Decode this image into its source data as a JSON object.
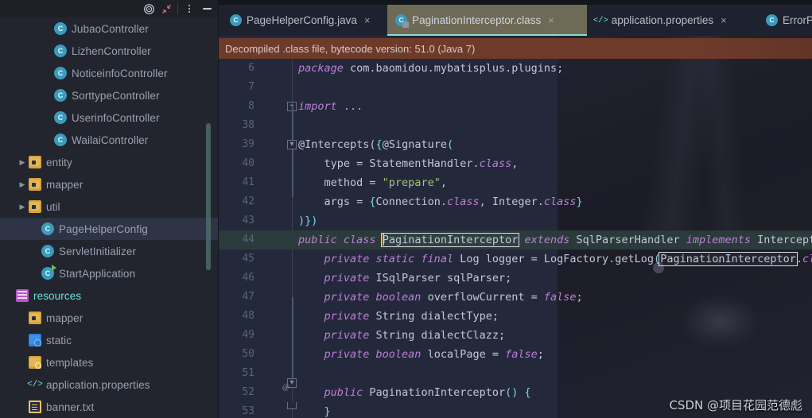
{
  "window": {
    "toolbar_buttons": [
      {
        "name": "locate-in-tree",
        "icon": "target-icon",
        "label": ""
      },
      {
        "name": "collapse-all",
        "icon": "collapse-arrows-icon",
        "label": ""
      },
      {
        "name": "options-menu",
        "icon": "kebab-menu-icon",
        "label": ""
      },
      {
        "name": "hide-panel",
        "icon": "minimize-icon",
        "label": ""
      }
    ]
  },
  "sidebar": {
    "items": [
      {
        "label": "JubaoController",
        "icon": "java-class-icon",
        "indent": 3,
        "arrow": "",
        "selected": false
      },
      {
        "label": "LizhenController",
        "icon": "java-class-icon",
        "indent": 3,
        "arrow": "",
        "selected": false
      },
      {
        "label": "NoticeinfoController",
        "icon": "java-class-icon",
        "indent": 3,
        "arrow": "",
        "selected": false
      },
      {
        "label": "SorttypeController",
        "icon": "java-class-icon",
        "indent": 3,
        "arrow": "",
        "selected": false
      },
      {
        "label": "UserinfoController",
        "icon": "java-class-icon",
        "indent": 3,
        "arrow": "",
        "selected": false
      },
      {
        "label": "WailaiController",
        "icon": "java-class-icon",
        "indent": 3,
        "arrow": "",
        "selected": false
      },
      {
        "label": "entity",
        "icon": "package-folder-icon",
        "indent": 1,
        "arrow": "▶",
        "selected": false
      },
      {
        "label": "mapper",
        "icon": "package-folder-icon",
        "indent": 1,
        "arrow": "▶",
        "selected": false
      },
      {
        "label": "util",
        "icon": "package-folder-icon",
        "indent": 1,
        "arrow": "▶",
        "selected": false
      },
      {
        "label": "PageHelperConfig",
        "icon": "java-class-icon",
        "indent": 2,
        "arrow": "",
        "selected": true
      },
      {
        "label": "ServletInitializer",
        "icon": "java-class-icon",
        "indent": 2,
        "arrow": "",
        "selected": false
      },
      {
        "label": "StartApplication",
        "icon": "java-class-runnable-icon",
        "indent": 2,
        "arrow": "",
        "selected": false
      },
      {
        "label": "resources",
        "icon": "resources-root-icon",
        "indent": 0,
        "arrow": "",
        "selected": false,
        "highlight": true
      },
      {
        "label": "mapper",
        "icon": "folder-icon",
        "indent": 1,
        "arrow": "",
        "selected": false
      },
      {
        "label": "static",
        "icon": "static-web-folder-icon",
        "indent": 1,
        "arrow": "",
        "selected": false
      },
      {
        "label": "templates",
        "icon": "templates-folder-icon",
        "indent": 1,
        "arrow": "",
        "selected": false
      },
      {
        "label": "application.properties",
        "icon": "properties-file-icon",
        "indent": 1,
        "arrow": "",
        "selected": false
      },
      {
        "label": "banner.txt",
        "icon": "text-file-icon",
        "indent": 1,
        "arrow": "",
        "selected": false
      }
    ]
  },
  "editor": {
    "tabs": [
      {
        "label": "PageHelperConfig.java",
        "icon": "java-class-icon",
        "active": false,
        "close": "×"
      },
      {
        "label": "PaginationInterceptor.class",
        "icon": "compiled-class-icon",
        "active": true,
        "close": "×"
      },
      {
        "label": "application.properties",
        "icon": "properties-file-icon",
        "active": false,
        "close": "×"
      },
      {
        "label": "ErrorPageController.java",
        "icon": "java-class-icon",
        "active": false,
        "close": "×"
      }
    ],
    "notice": "Decompiled .class file, bytecode version: 51.0 (Java 7)",
    "lines": [
      {
        "no": "6",
        "html": "<span class=\"kw\">package</span> com.baomidou.mybatisplus.plugins;"
      },
      {
        "no": "7",
        "html": ""
      },
      {
        "no": "8",
        "html": "<span class=\"kw\">import</span> <span class=\"str\">...</span>"
      },
      {
        "no": "38",
        "html": ""
      },
      {
        "no": "39",
        "html": "@Intercepts(<span class=\"pun\">{</span>@Signature<span class=\"pun\">(</span>"
      },
      {
        "no": "40",
        "html": "    type = StatementHandler.<span class=\"kw\">class</span>,"
      },
      {
        "no": "41",
        "html": "    method = <span class=\"str\">\"prepare\"</span>,"
      },
      {
        "no": "42",
        "html": "    args = <span class=\"pun\">{</span>Connection.<span class=\"kw\">class</span>, Integer.<span class=\"kw\">class</span><span class=\"pun\">}</span>"
      },
      {
        "no": "43",
        "html": "<span class=\"pun\">)}</span><span class=\"pun\">)</span>"
      },
      {
        "no": "44",
        "html": "<span class=\"kw\">public class</span> <span class=\"caret\"></span><span class=\"boxed\">PaginationInterceptor</span> <span class=\"kw\">extends</span> SqlParserHandler <span class=\"kw\">implements</span> Interceptor <span class=\"pun\">{</span>",
        "current": true
      },
      {
        "no": "45",
        "html": "    <span class=\"kw\">private static final</span> Log logger = LogFactory.getLog<span class=\"pun\">(</span><span class=\"boxed\">PaginationInterceptor</span>.<span class=\"kw\">class</span><span class=\"pun\">)</span>;"
      },
      {
        "no": "46",
        "html": "    <span class=\"kw\">private</span> ISqlParser sqlParser;"
      },
      {
        "no": "47",
        "html": "    <span class=\"kw\">private boolean</span> overflowCurrent = <span class=\"kw\">false</span>;"
      },
      {
        "no": "48",
        "html": "    <span class=\"kw\">private</span> String dialectType;"
      },
      {
        "no": "49",
        "html": "    <span class=\"kw\">private</span> String dialectClazz;"
      },
      {
        "no": "50",
        "html": "    <span class=\"kw\">private boolean</span> localPage = <span class=\"kw\">false</span>;"
      },
      {
        "no": "51",
        "html": ""
      },
      {
        "no": "52",
        "html": "    <span class=\"kw\">public</span> PaginationInterceptor<span class=\"pun\">()</span> <span class=\"pun\">{</span>"
      },
      {
        "no": "53",
        "html": "    <span class=\"pun\">}</span>"
      }
    ],
    "gutter_icons": [
      {
        "line": "44",
        "name": "class-marker-icon"
      },
      {
        "line": "44",
        "name": "implemented-by-icon"
      },
      {
        "line": "52",
        "name": "override-annotation-icon"
      }
    ]
  },
  "watermark": "CSDN @项目花园范德彪"
}
